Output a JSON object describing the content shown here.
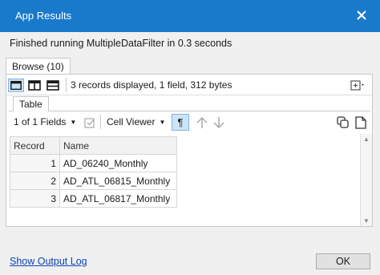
{
  "window": {
    "title": "App Results"
  },
  "status": {
    "message": "Finished running MultipleDataFilter in 0.3 seconds"
  },
  "tabs": {
    "browse_label": "Browse (10)"
  },
  "toolbar": {
    "records_info": "3 records displayed, 1 field, 312 bytes"
  },
  "subtabs": {
    "table_label": "Table"
  },
  "table_toolbar": {
    "fields_label": "1 of 1 Fields",
    "viewer_label": "Cell Viewer",
    "paragraph_glyph": "¶"
  },
  "grid": {
    "headers": [
      "Record",
      "Name"
    ],
    "rows": [
      {
        "record": "1",
        "name": "AD_06240_Monthly"
      },
      {
        "record": "2",
        "name": "AD_ATL_06815_Monthly"
      },
      {
        "record": "3",
        "name": "AD_ATL_06817_Monthly"
      }
    ]
  },
  "footer": {
    "link_label": "Show Output Log",
    "ok_label": "OK"
  },
  "colors": {
    "titlebar": "#1979ca",
    "link": "#0b44b8",
    "active_button": "#cde4f7"
  }
}
